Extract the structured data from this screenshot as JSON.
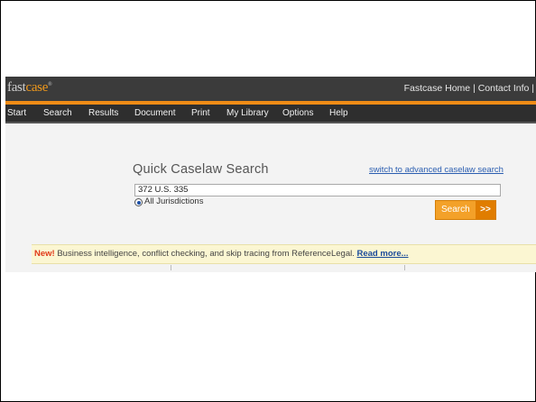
{
  "header": {
    "logo_part1": "fast",
    "logo_part2": "case",
    "logo_mark": "®",
    "home_link": "Fastcase Home",
    "separator": "|",
    "contact_link": "Contact Info",
    "trailing_separator": "|"
  },
  "menu": {
    "items": [
      "Start",
      "Search",
      "Results",
      "Document",
      "Print",
      "My Library",
      "Options",
      "Help"
    ]
  },
  "search": {
    "title": "Quick Caselaw Search",
    "advanced_link": "switch to advanced caselaw search",
    "query_value": "372 U.S. 335",
    "jurisdiction_option": "All Jurisdictions",
    "button_label": "Search",
    "button_arrow": ">>"
  },
  "banner": {
    "new_label": "New!",
    "message": " Business intelligence, conflict checking, and skip tracing from ReferenceLegal. ",
    "link_text": "Read more..."
  },
  "colors": {
    "brand_orange": "#f08c16",
    "topbar": "#3b3b3b",
    "menubar": "#2e2e2e",
    "link_blue": "#2a5db0",
    "banner_bg": "#fbf6d2"
  }
}
